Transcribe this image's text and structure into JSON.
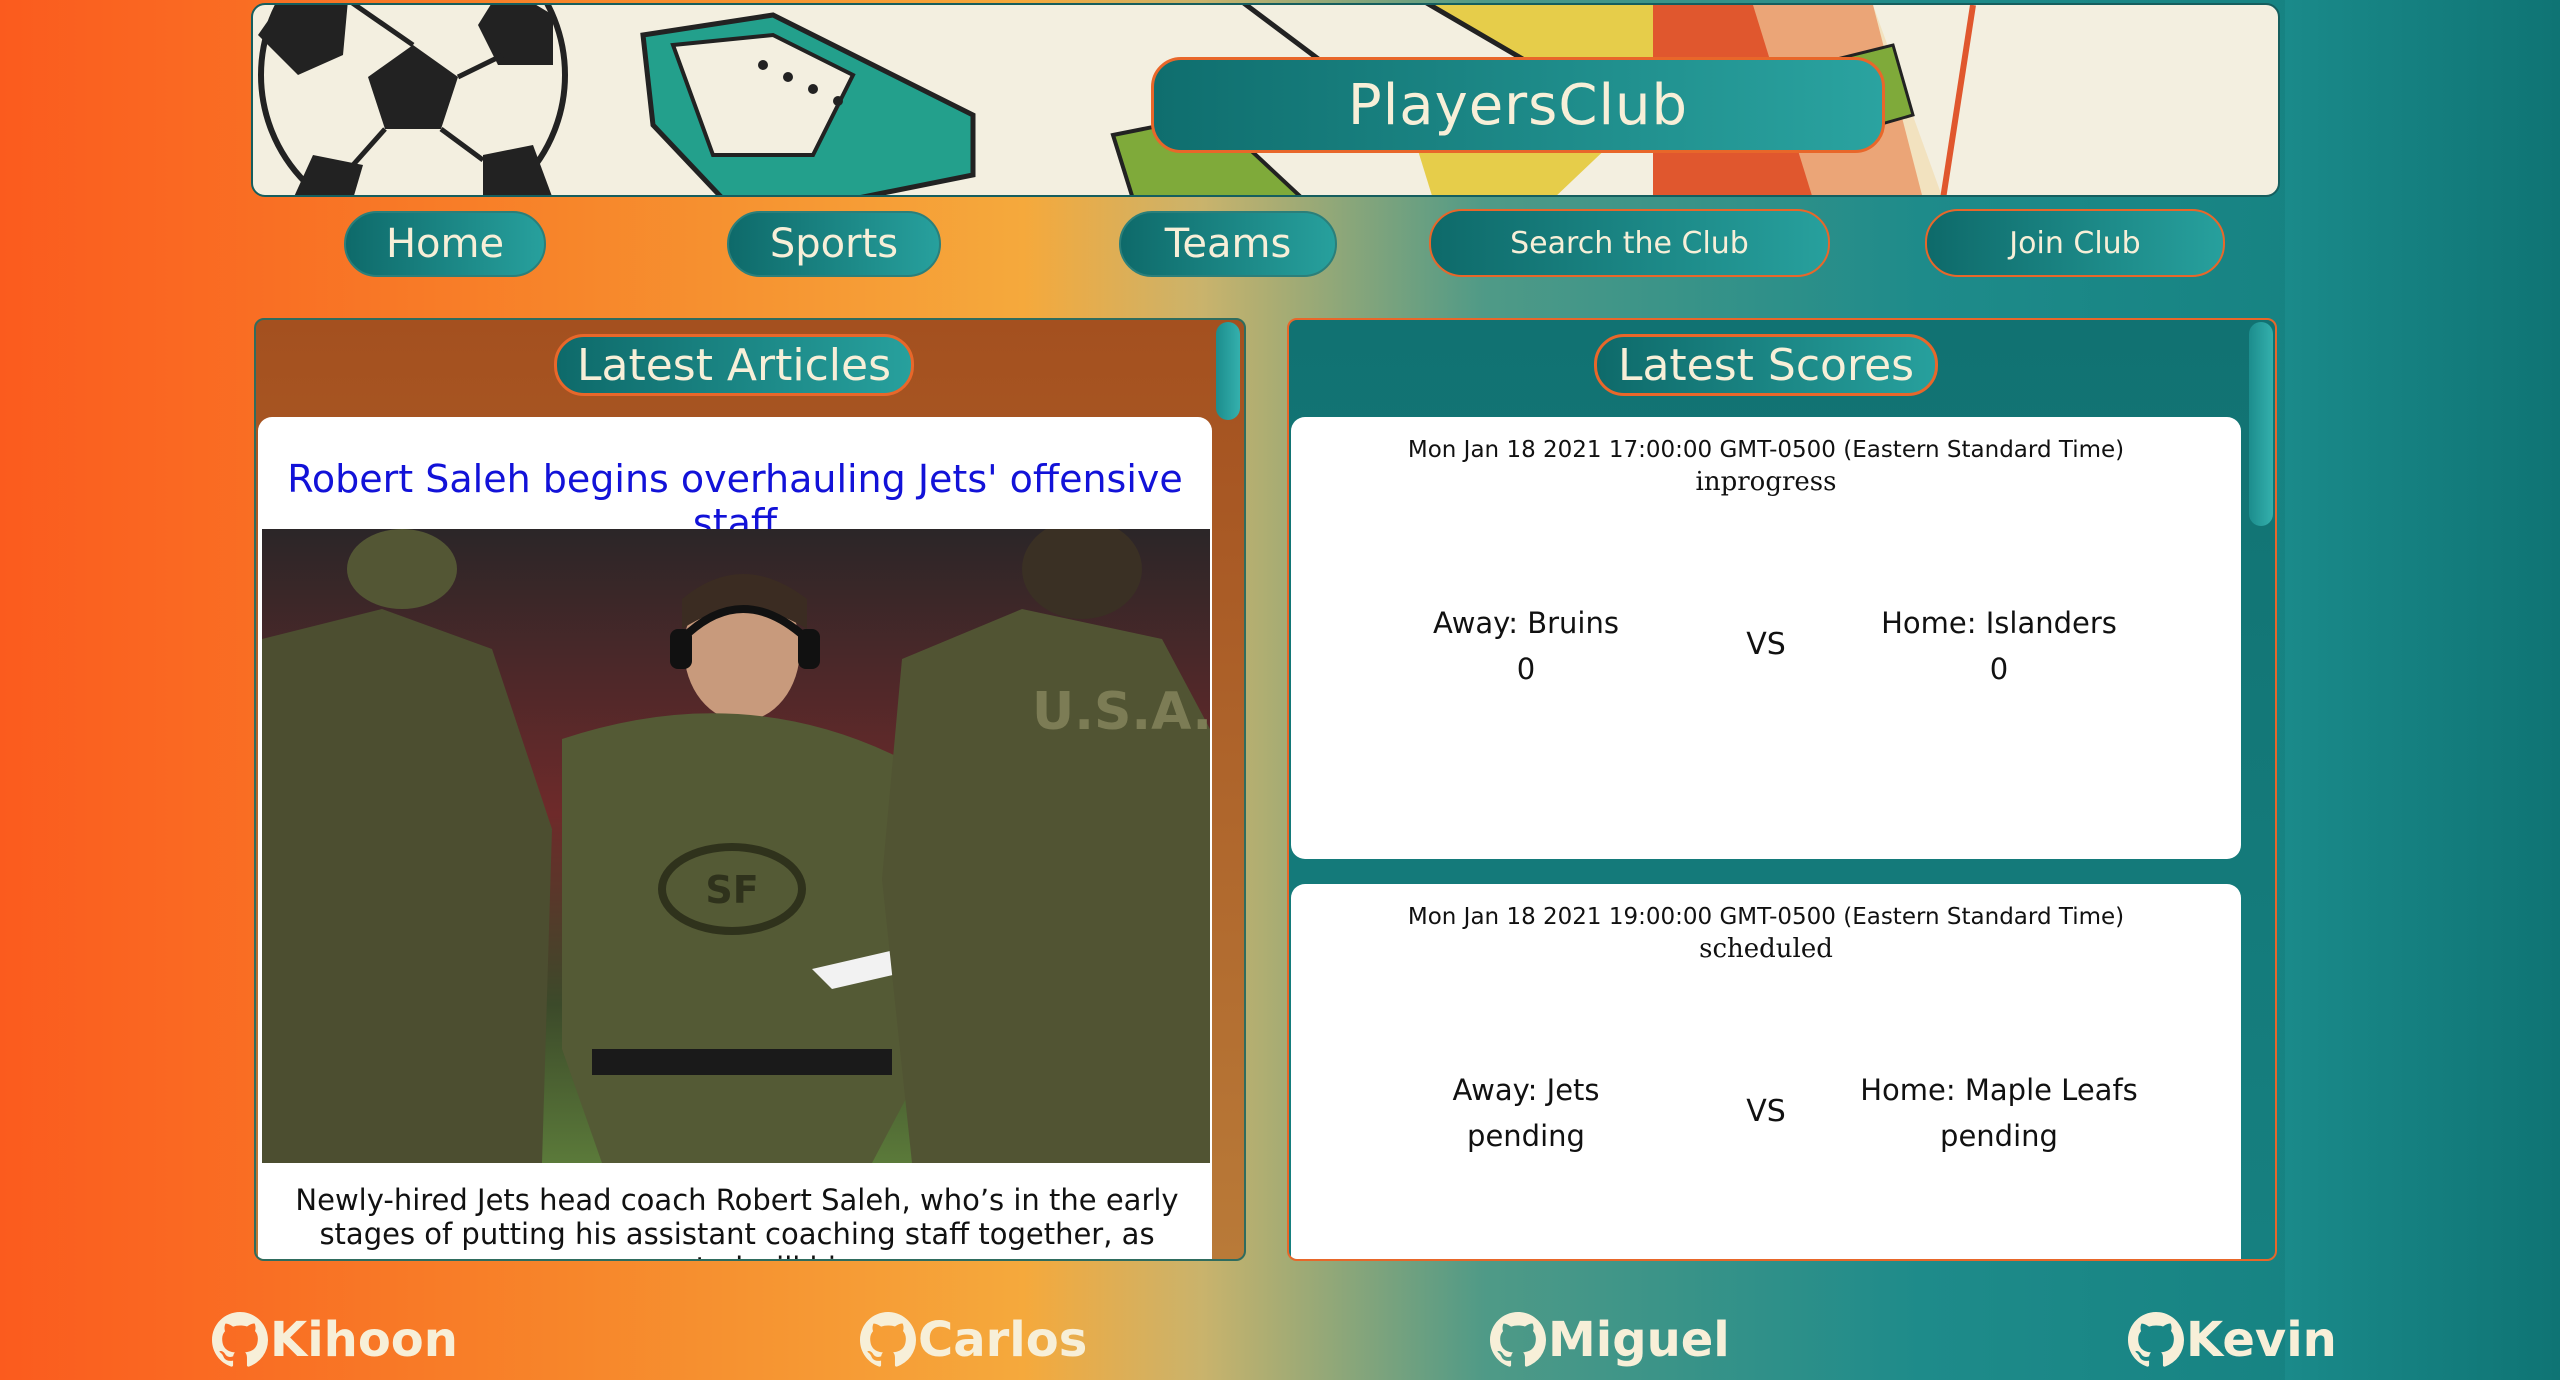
{
  "site": {
    "title": "PlayersClub"
  },
  "nav": {
    "items": [
      {
        "label": "Home"
      },
      {
        "label": "Sports"
      },
      {
        "label": "Teams"
      },
      {
        "label": "Search the Club"
      },
      {
        "label": "Join Club"
      }
    ]
  },
  "articles": {
    "heading": "Latest Articles",
    "items": [
      {
        "title": "Robert Saleh begins overhauling Jets' offensive staff",
        "jersey_text": "U.S.A.",
        "excerpt": "Newly-hired Jets head coach Robert Saleh, who’s in the early stages of putting his assistant coaching staff together, as expected will hire"
      }
    ]
  },
  "scores": {
    "heading": "Latest Scores",
    "games": [
      {
        "date": "Mon Jan 18 2021 17:00:00 GMT-0500 (Eastern Standard Time)",
        "status": "inprogress",
        "away_label": "Away: Bruins",
        "away_score": "0",
        "vs": "VS",
        "home_label": "Home: Islanders",
        "home_score": "0"
      },
      {
        "date": "Mon Jan 18 2021 19:00:00 GMT-0500 (Eastern Standard Time)",
        "status": "scheduled",
        "away_label": "Away: Jets",
        "away_score": "pending",
        "vs": "VS",
        "home_label": "Home: Maple Leafs",
        "home_score": "pending"
      }
    ]
  },
  "footer": {
    "contributors": [
      {
        "name": "Kihoon"
      },
      {
        "name": "Carlos"
      },
      {
        "name": "Miguel"
      },
      {
        "name": "Kevin"
      }
    ]
  },
  "colors": {
    "accent_orange": "#e8672a",
    "teal": "#117d7d",
    "cream": "#f7efd8",
    "link_blue": "#1212d8"
  }
}
